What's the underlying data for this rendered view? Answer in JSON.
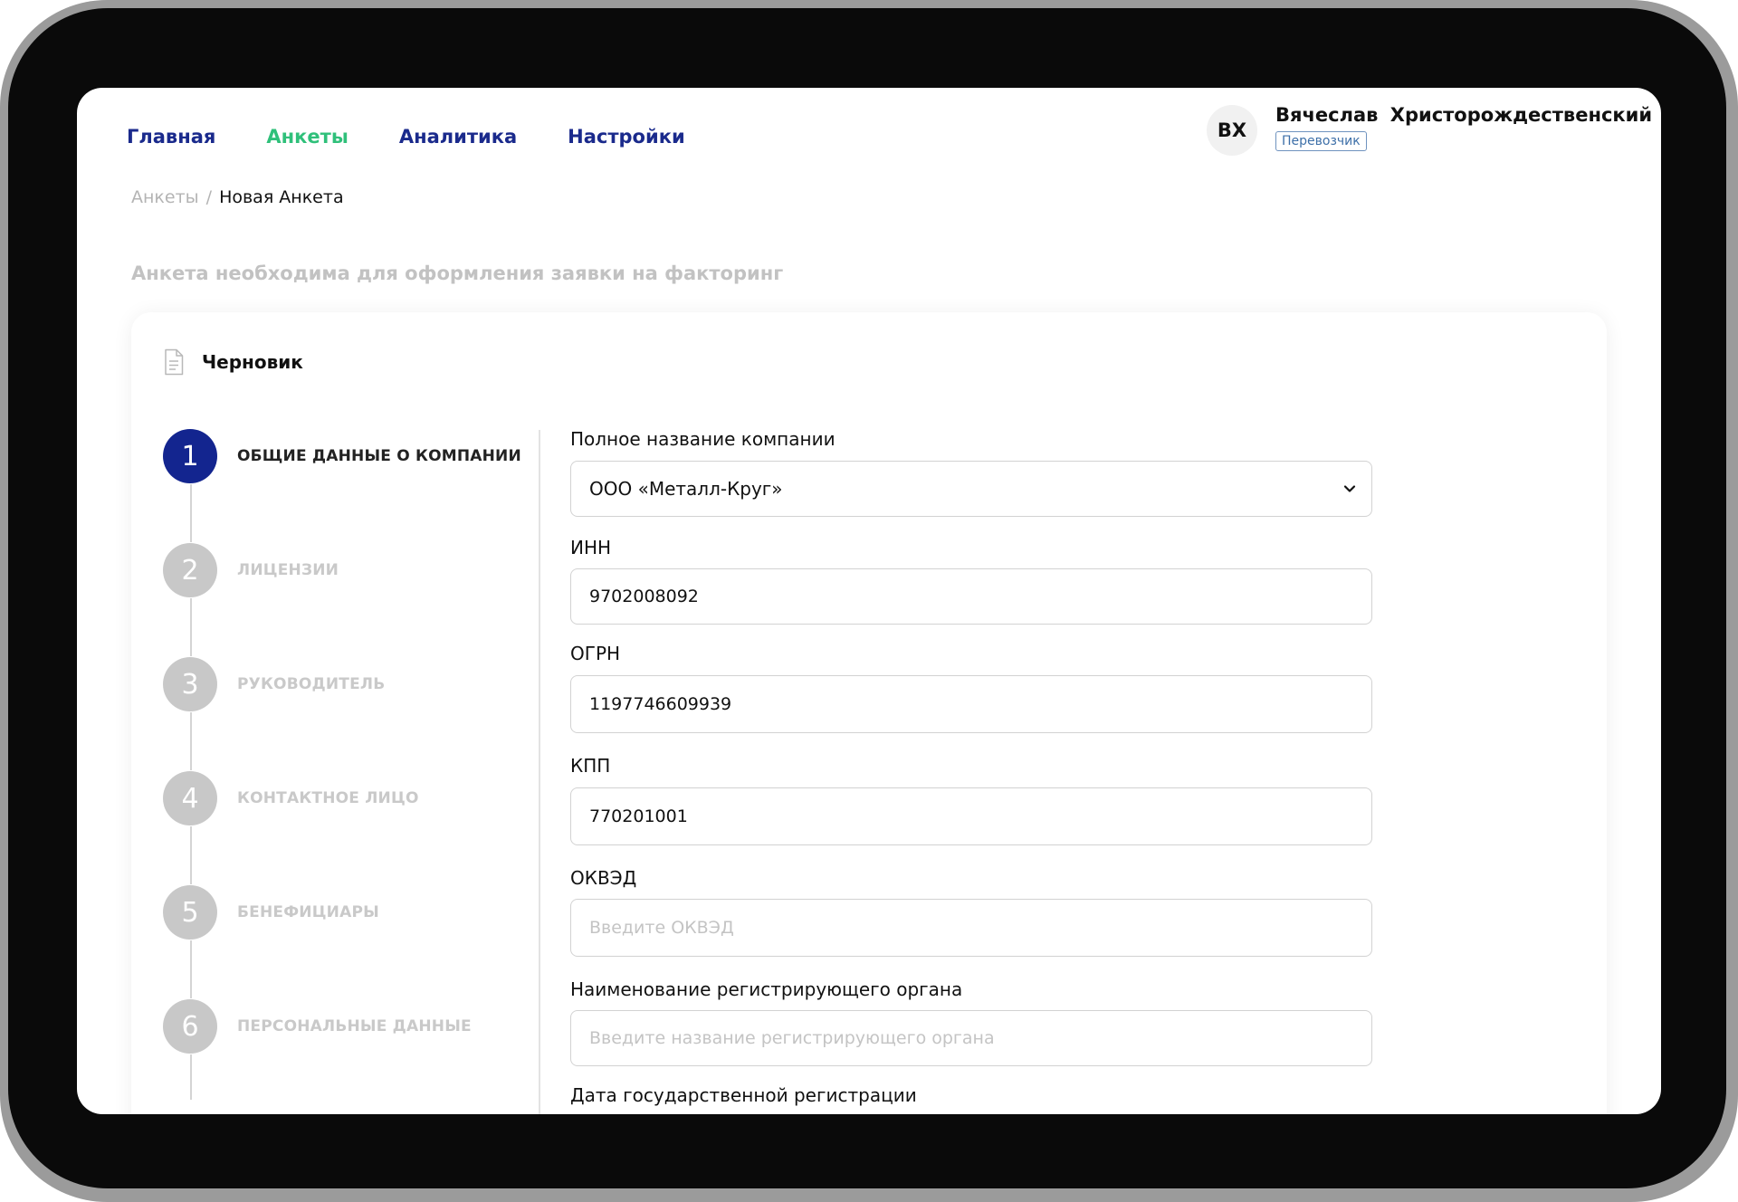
{
  "nav": {
    "items": [
      {
        "label": "Главная",
        "active": false
      },
      {
        "label": "Анкеты",
        "active": true
      },
      {
        "label": "Аналитика",
        "active": false
      },
      {
        "label": "Настройки",
        "active": false
      }
    ]
  },
  "user": {
    "initials": "ВХ",
    "name": "Вячеслав Христорождественский",
    "role": "Перевозчик"
  },
  "breadcrumb": {
    "parent": "Анкеты",
    "separator": "/",
    "current": "Новая Анкета"
  },
  "subtitle": "Анкета необходима для оформления заявки на факторинг",
  "status": {
    "icon": "document-icon",
    "label": "Черновик"
  },
  "steps": [
    {
      "number": "1",
      "label": "ОБЩИЕ ДАННЫЕ О КОМПАНИИ",
      "active": true
    },
    {
      "number": "2",
      "label": "ЛИЦЕНЗИИ",
      "active": false
    },
    {
      "number": "3",
      "label": "РУКОВОДИТЕЛЬ",
      "active": false
    },
    {
      "number": "4",
      "label": "КОНТАКТНОЕ ЛИЦО",
      "active": false
    },
    {
      "number": "5",
      "label": "БЕНЕФИЦИАРЫ",
      "active": false
    },
    {
      "number": "6",
      "label": "ПЕРСОНАЛЬНЫЕ ДАННЫЕ",
      "active": false
    }
  ],
  "form": {
    "company": {
      "label": "Полное название компании",
      "value": "ООО «Металл-Круг»"
    },
    "inn": {
      "label": "ИНН",
      "value": "9702008092"
    },
    "ogrn": {
      "label": "ОГРН",
      "value": "1197746609939"
    },
    "kpp": {
      "label": "КПП",
      "value": "770201001"
    },
    "okved": {
      "label": "ОКВЭД",
      "placeholder": "Введите ОКВЭД"
    },
    "reg_authority": {
      "label": "Наименование регистрирующего органа",
      "placeholder": "Введите название регистрирующего органа"
    },
    "reg_date": {
      "label": "Дата государственной регистрации"
    }
  },
  "colors": {
    "brand": "#13258f",
    "nav_active": "#2fc07a",
    "step_inactive": "#c8c8c8"
  }
}
